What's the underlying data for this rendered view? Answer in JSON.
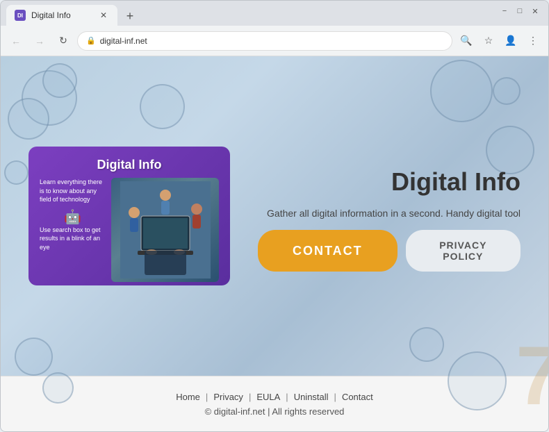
{
  "browser": {
    "tab_title": "Digital Info",
    "tab_favicon_text": "DI",
    "new_tab_label": "+",
    "window_controls": {
      "minimize": "−",
      "maximize": "□",
      "close": "✕"
    },
    "nav": {
      "back": "←",
      "forward": "→",
      "refresh": "↻"
    },
    "address_bar": {
      "url": "digital-inf.net",
      "lock_icon": "🔒"
    },
    "toolbar_icons": {
      "search": "🔍",
      "star": "☆",
      "profile": "👤",
      "menu": "⋮"
    }
  },
  "page": {
    "title": "Digital Info",
    "tagline": "Gather all digital information in a second. Handy digital tool",
    "card": {
      "title": "Digital Info",
      "text1": "Learn everything there is to know about any field of technology",
      "icon": "🤖",
      "text2": "Use search box to get results in a blink of an eye"
    },
    "buttons": {
      "contact": "CONTACT",
      "privacy": "PRIVACY POLICY"
    },
    "bg_logo": "7"
  },
  "footer": {
    "links": [
      {
        "label": "Home"
      },
      {
        "label": "Privacy"
      },
      {
        "label": "EULA"
      },
      {
        "label": "Uninstall"
      },
      {
        "label": "Contact"
      }
    ],
    "copyright": "© digital-inf.net | All rights reserved"
  }
}
